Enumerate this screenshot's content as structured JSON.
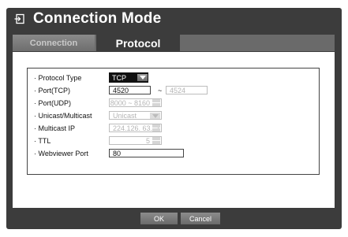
{
  "dialog": {
    "title": "Connection Mode",
    "title_icon": "connection-mode-icon"
  },
  "tabs": [
    {
      "label": "Connection",
      "active": false
    },
    {
      "label": "Protocol",
      "active": true
    }
  ],
  "fields": {
    "protocol_type": {
      "label": "· Protocol Type",
      "value": "TCP"
    },
    "port_tcp": {
      "label": "· Port(TCP)",
      "value_from": "4520",
      "separator": "~",
      "value_to": "4524"
    },
    "port_udp": {
      "label": "· Port(UDP)",
      "value": "8000 ~ 8160"
    },
    "unicast_multicast": {
      "label": "· Unicast/Multicast",
      "value": "Unicast"
    },
    "multicast_ip": {
      "label": "· Multicast IP",
      "value": "224.126. 63.  1"
    },
    "ttl": {
      "label": "· TTL",
      "value": "5"
    },
    "webviewer_port": {
      "label": "· Webviewer Port",
      "value": "80"
    }
  },
  "buttons": {
    "ok_label": "OK",
    "cancel_label": "Cancel"
  },
  "colors": {
    "frame_bg": "#3c3c3c",
    "panel_bg": "#ffffff",
    "accent_select": "#111111"
  }
}
